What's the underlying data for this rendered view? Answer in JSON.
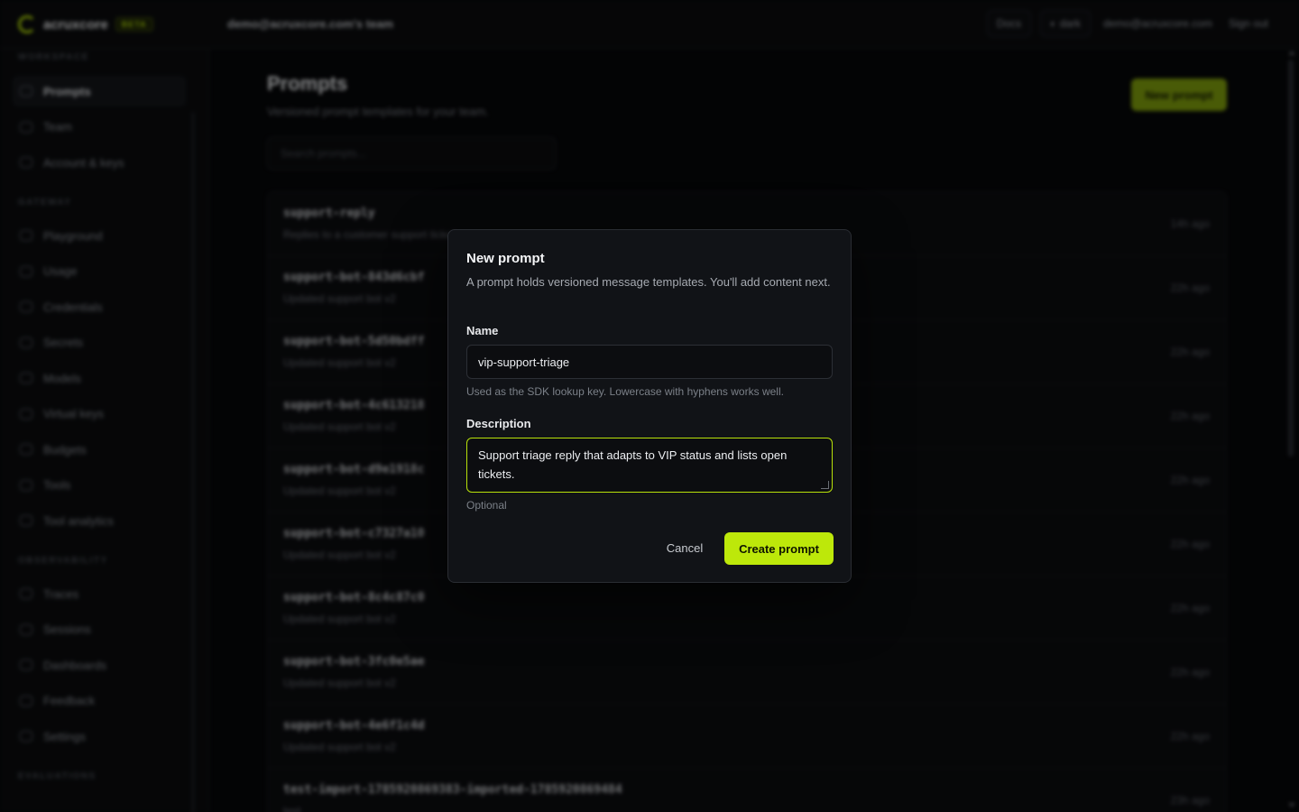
{
  "brand": {
    "name": "acruxcore",
    "badge": "BETA"
  },
  "header": {
    "team": "demo@acruxcore.com's team",
    "docs": "Docs",
    "dark": "◐ dark",
    "email": "demo@acruxcore.com",
    "signout": "Sign out"
  },
  "sidebar": {
    "sections": [
      {
        "title": "WORKSPACE",
        "items": [
          "Prompts",
          "Team",
          "Account & keys"
        ]
      },
      {
        "title": "GATEWAY",
        "items": [
          "Playground",
          "Usage",
          "Credentials",
          "Secrets",
          "Models",
          "Virtual keys",
          "Budgets",
          "Tools",
          "Tool analytics"
        ]
      },
      {
        "title": "OBSERVABILITY",
        "items": [
          "Traces",
          "Sessions",
          "Dashboards",
          "Feedback",
          "Settings"
        ]
      },
      {
        "title": "EVALUATIONS",
        "items": []
      }
    ],
    "active": "Prompts"
  },
  "main": {
    "title": "Prompts",
    "subtitle": "Versioned prompt templates for your team.",
    "new_button": "New prompt",
    "search_placeholder": "Search prompts...",
    "rows": [
      {
        "name": "support-reply",
        "desc": "Replies to a customer support ticket",
        "time": "14h ago"
      },
      {
        "name": "support-bot-843d6cbf",
        "desc": "Updated support bot v2",
        "time": "22h ago"
      },
      {
        "name": "support-bot-5d50bdff",
        "desc": "Updated support bot v2",
        "time": "22h ago"
      },
      {
        "name": "support-bot-4c613218",
        "desc": "Updated support bot v2",
        "time": "22h ago"
      },
      {
        "name": "support-bot-d9e1918c",
        "desc": "Updated support bot v2",
        "time": "22h ago"
      },
      {
        "name": "support-bot-c7327a10",
        "desc": "Updated support bot v2",
        "time": "22h ago"
      },
      {
        "name": "support-bot-8c4c87c0",
        "desc": "Updated support bot v2",
        "time": "22h ago"
      },
      {
        "name": "support-bot-3fc0e5ae",
        "desc": "Updated support bot v2",
        "time": "22h ago"
      },
      {
        "name": "support-bot-4e6f1c4d",
        "desc": "Updated support bot v2",
        "time": "22h ago"
      },
      {
        "name": "test-import-1785920869383-imported-1785920869484",
        "desc": "test",
        "time": "23h ago"
      }
    ]
  },
  "dialog": {
    "title": "New prompt",
    "description": "A prompt holds versioned message templates. You'll add content next.",
    "name_label": "Name",
    "name_value": "vip-support-triage",
    "name_hint": "Used as the SDK lookup key. Lowercase with hyphens works well.",
    "description_label": "Description",
    "description_value": "Support triage reply that adapts to VIP status and lists open tickets.",
    "description_hint": "Optional",
    "cancel": "Cancel",
    "create": "Create prompt"
  },
  "colors": {
    "accent": "#bde80a",
    "background": "#07080a",
    "dialog": "#111317"
  }
}
